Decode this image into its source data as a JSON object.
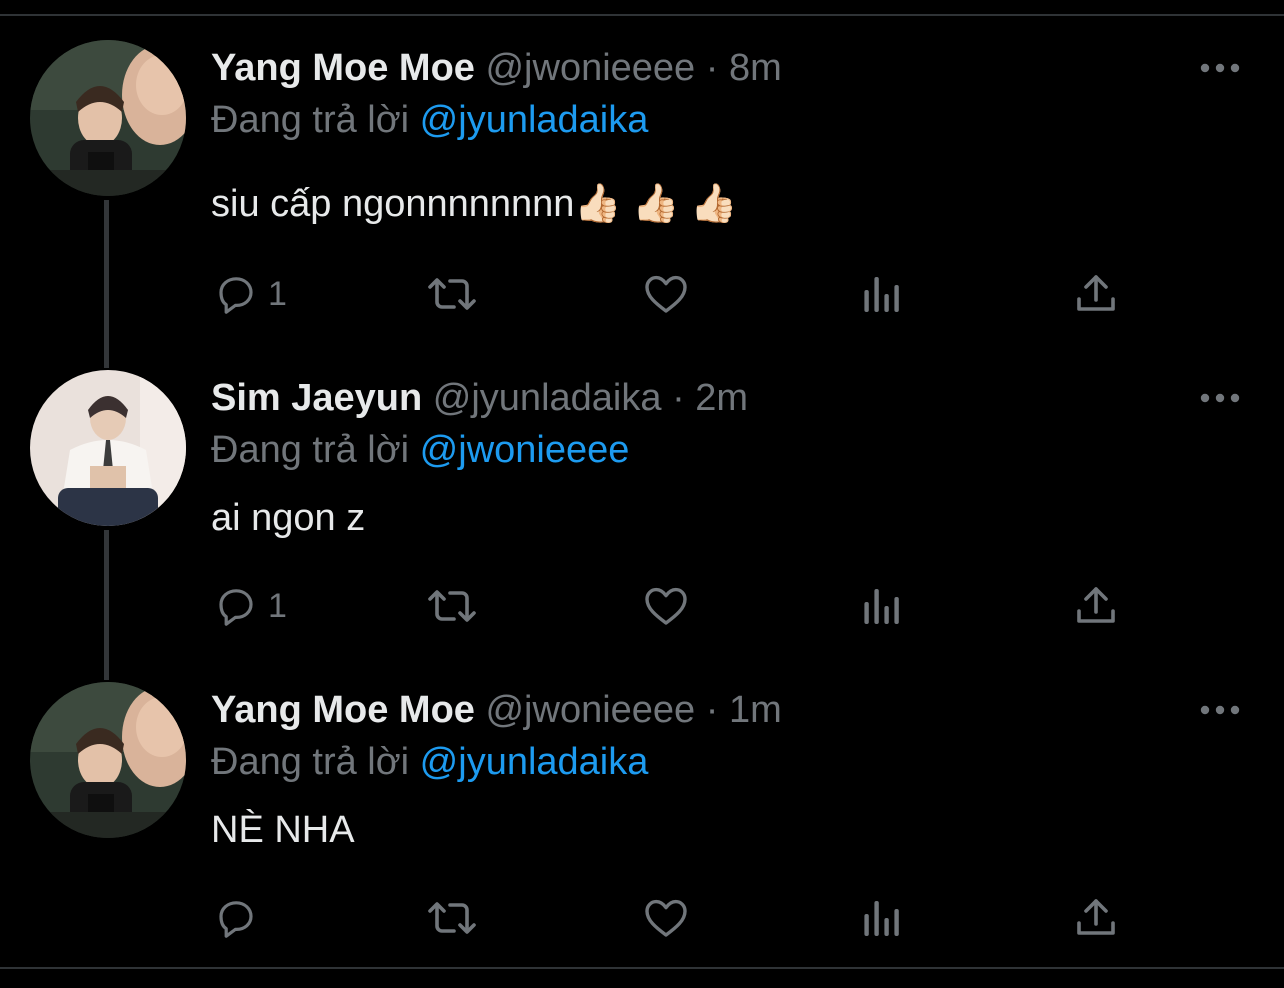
{
  "colors": {
    "background": "#000000",
    "primary_text": "#e7e9ea",
    "secondary_text": "#71767b",
    "accent": "#1d9bf0",
    "divider": "#2f3336"
  },
  "tweets": [
    {
      "display_name": "Yang Moe Moe",
      "handle": "@jwonieeee",
      "separator": "·",
      "time": "8m",
      "replying_prefix": "Đang trả lời",
      "replying_to": "@jyunladaika",
      "text": "siu cấp ngonnnnnnnn👍🏻 👍🏻 👍🏻",
      "reply_count": "1",
      "avatar": "avatar-yang-moe-moe",
      "icons": [
        "reply-icon",
        "retweet-icon",
        "like-icon",
        "analytics-icon",
        "share-icon",
        "more-icon"
      ]
    },
    {
      "display_name": "Sim Jaeyun",
      "handle": "@jyunladaika",
      "separator": "·",
      "time": "2m",
      "replying_prefix": "Đang trả lời",
      "replying_to": "@jwonieeee",
      "text": "ai ngon z",
      "reply_count": "1",
      "avatar": "avatar-sim-jaeyun",
      "icons": [
        "reply-icon",
        "retweet-icon",
        "like-icon",
        "analytics-icon",
        "share-icon",
        "more-icon"
      ]
    },
    {
      "display_name": "Yang Moe Moe",
      "handle": "@jwonieeee",
      "separator": "·",
      "time": "1m",
      "replying_prefix": "Đang trả lời",
      "replying_to": "@jyunladaika",
      "text": "NÈ NHA",
      "reply_count": "",
      "avatar": "avatar-yang-moe-moe",
      "icons": [
        "reply-icon",
        "retweet-icon",
        "like-icon",
        "analytics-icon",
        "share-icon",
        "more-icon"
      ]
    }
  ]
}
